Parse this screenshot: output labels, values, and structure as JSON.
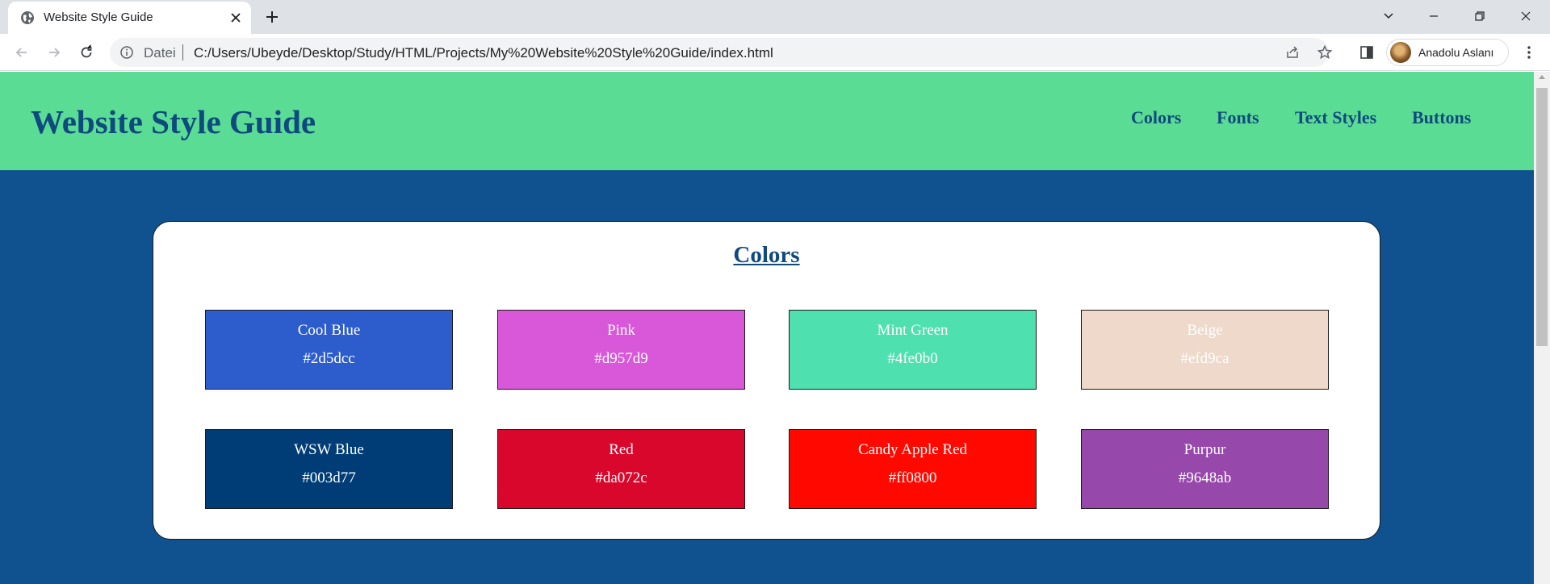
{
  "browser": {
    "tab_title": "Website Style Guide",
    "url_scheme_label": "Datei",
    "url": "C:/Users/Ubeyde/Desktop/Study/HTML/Projects/My%20Website%20Style%20Guide/index.html",
    "profile_name": "Anadolu Aslanı"
  },
  "site": {
    "title": "Website Style Guide",
    "nav": [
      "Colors",
      "Fonts",
      "Text Styles",
      "Buttons"
    ]
  },
  "colors_section": {
    "title": "Colors",
    "swatches": [
      {
        "name": "Cool Blue",
        "hex": "#2d5dcc",
        "text_color": "#ffffff"
      },
      {
        "name": "Pink",
        "hex": "#d957d9",
        "text_color": "#ffffff"
      },
      {
        "name": "Mint Green",
        "hex": "#4fe0b0",
        "text_color": "#ffffff"
      },
      {
        "name": "Beige",
        "hex": "#efd9ca",
        "text_color": "#ffffff"
      },
      {
        "name": "WSW Blue",
        "hex": "#003d77",
        "text_color": "#ffffff"
      },
      {
        "name": "Red",
        "hex": "#da072c",
        "text_color": "#ffffff"
      },
      {
        "name": "Candy Apple Red",
        "hex": "#ff0800",
        "text_color": "#ffffff"
      },
      {
        "name": "Purpur",
        "hex": "#9648ab",
        "text_color": "#ffffff"
      }
    ]
  },
  "theme": {
    "header_bg": "#5bdc94",
    "page_bg": "#10518f",
    "heading_color": "#0e4a7e"
  }
}
